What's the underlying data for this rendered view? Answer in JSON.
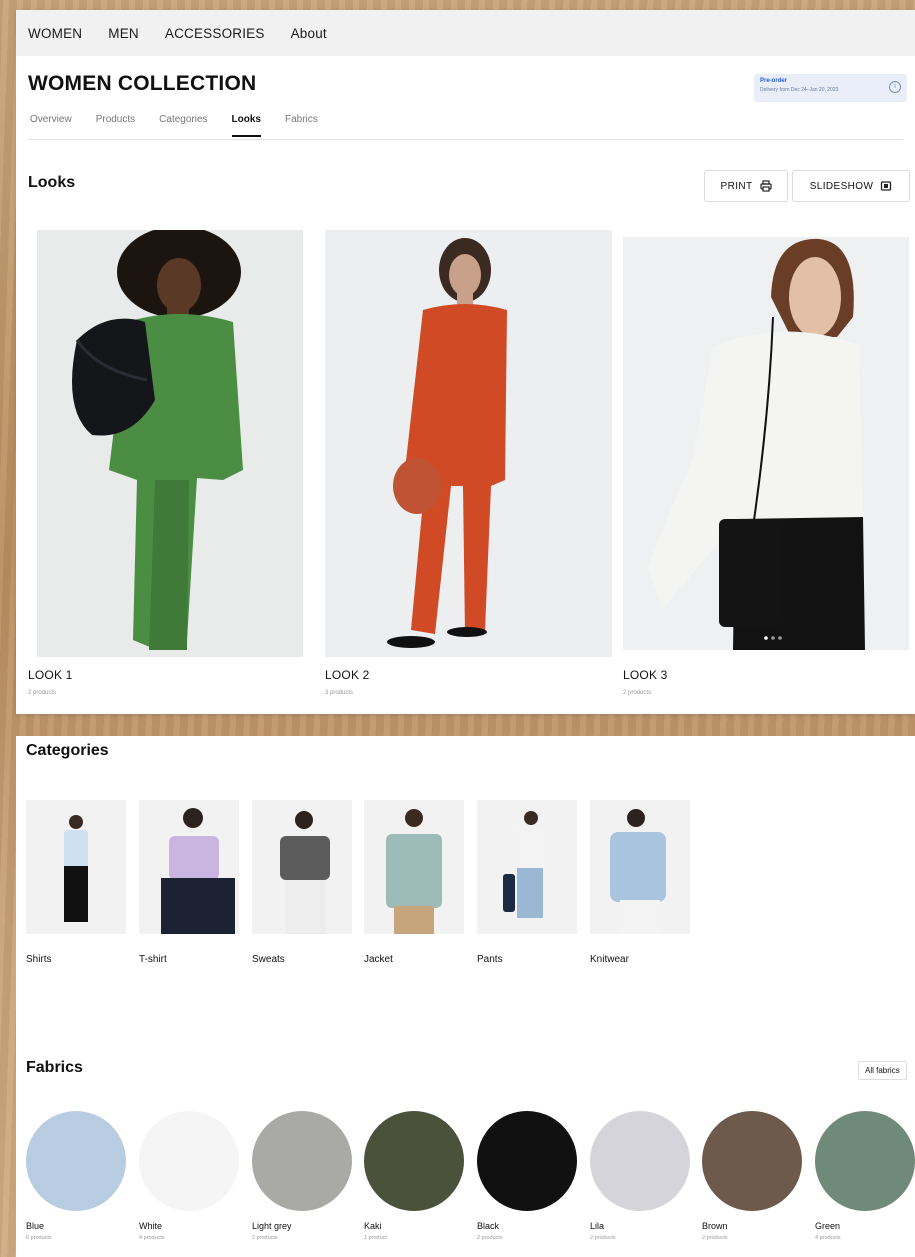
{
  "nav": {
    "items": [
      "WOMEN",
      "MEN",
      "ACCESSORIES",
      "About"
    ]
  },
  "page": {
    "title": "WOMEN COLLECTION",
    "preorder": {
      "title": "Pre-order",
      "subtitle": "Delivery from Dec 24–Jan 20, 2023"
    }
  },
  "tabs": [
    {
      "label": "Overview",
      "active": false
    },
    {
      "label": "Products",
      "active": false
    },
    {
      "label": "Categories",
      "active": false
    },
    {
      "label": "Looks",
      "active": true
    },
    {
      "label": "Fabrics",
      "active": false
    }
  ],
  "looks": {
    "heading": "Looks",
    "print_label": "PRINT",
    "slideshow_label": "SLIDESHOW",
    "items": [
      {
        "name": "LOOK 1",
        "sub": "2 products",
        "outfit": "#4b8e43"
      },
      {
        "name": "LOOK 2",
        "sub": "3 products",
        "outfit": "#d14a26"
      },
      {
        "name": "LOOK 3",
        "sub": "2 products",
        "outfit": "#f4f4f2"
      }
    ]
  },
  "categories": {
    "heading": "Categories",
    "items": [
      {
        "label": "Shirts",
        "top": "#cfe0f0",
        "bottom": "#111111"
      },
      {
        "label": "T-shirt",
        "top": "#c9b6e0",
        "bottom": "#1d2233"
      },
      {
        "label": "Sweats",
        "top": "#5c5c5c",
        "bottom": "#ededed"
      },
      {
        "label": "Jacket",
        "top": "#9dbbb6",
        "bottom": "#c6a57c"
      },
      {
        "label": "Pants",
        "top": "#f3f3f3",
        "bottom": "#9ab8d4"
      },
      {
        "label": "Knitwear",
        "top": "#a9c4df",
        "bottom": "#f4f4f4"
      }
    ]
  },
  "fabrics": {
    "heading": "Fabrics",
    "all_label": "All fabrics",
    "items": [
      {
        "name": "Blue",
        "sub": "6 products",
        "color": "#b8cde2"
      },
      {
        "name": "White",
        "sub": "4 products",
        "color": "#f5f5f5"
      },
      {
        "name": "Light grey",
        "sub": "2 products",
        "color": "#a9a9a6"
      },
      {
        "name": "Kaki",
        "sub": "1 product",
        "color": "#4a523c"
      },
      {
        "name": "Black",
        "sub": "2 products",
        "color": "#111111"
      },
      {
        "name": "Lila",
        "sub": "2 products",
        "color": "#d5d4db"
      },
      {
        "name": "Brown",
        "sub": "2 products",
        "color": "#6e5a4c"
      },
      {
        "name": "Green",
        "sub": "4 products",
        "color": "#6f8a79"
      }
    ]
  }
}
